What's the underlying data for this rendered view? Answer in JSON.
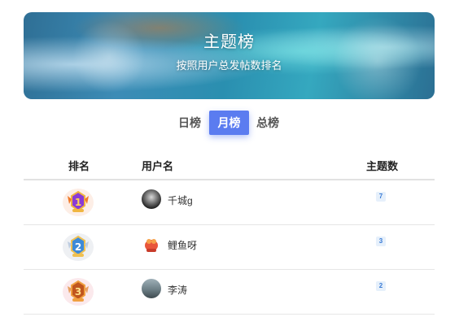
{
  "banner": {
    "title": "主题榜",
    "subtitle": "按照用户总发帖数排名"
  },
  "tabs": [
    {
      "label": "日榜",
      "active": false
    },
    {
      "label": "月榜",
      "active": true
    },
    {
      "label": "总榜",
      "active": false
    }
  ],
  "table": {
    "headers": {
      "rank": "排名",
      "user": "用户名",
      "count": "主题数"
    },
    "rows": [
      {
        "rank": 1,
        "username": "千城g",
        "count": "7"
      },
      {
        "rank": 2,
        "username": "鲤鱼呀",
        "count": "3"
      },
      {
        "rank": 3,
        "username": "李涛",
        "count": "2"
      }
    ]
  },
  "colors": {
    "accent": "#5b7cf0",
    "badge_text": "#3a7bd5",
    "badge_bg": "#e6f0fb"
  }
}
